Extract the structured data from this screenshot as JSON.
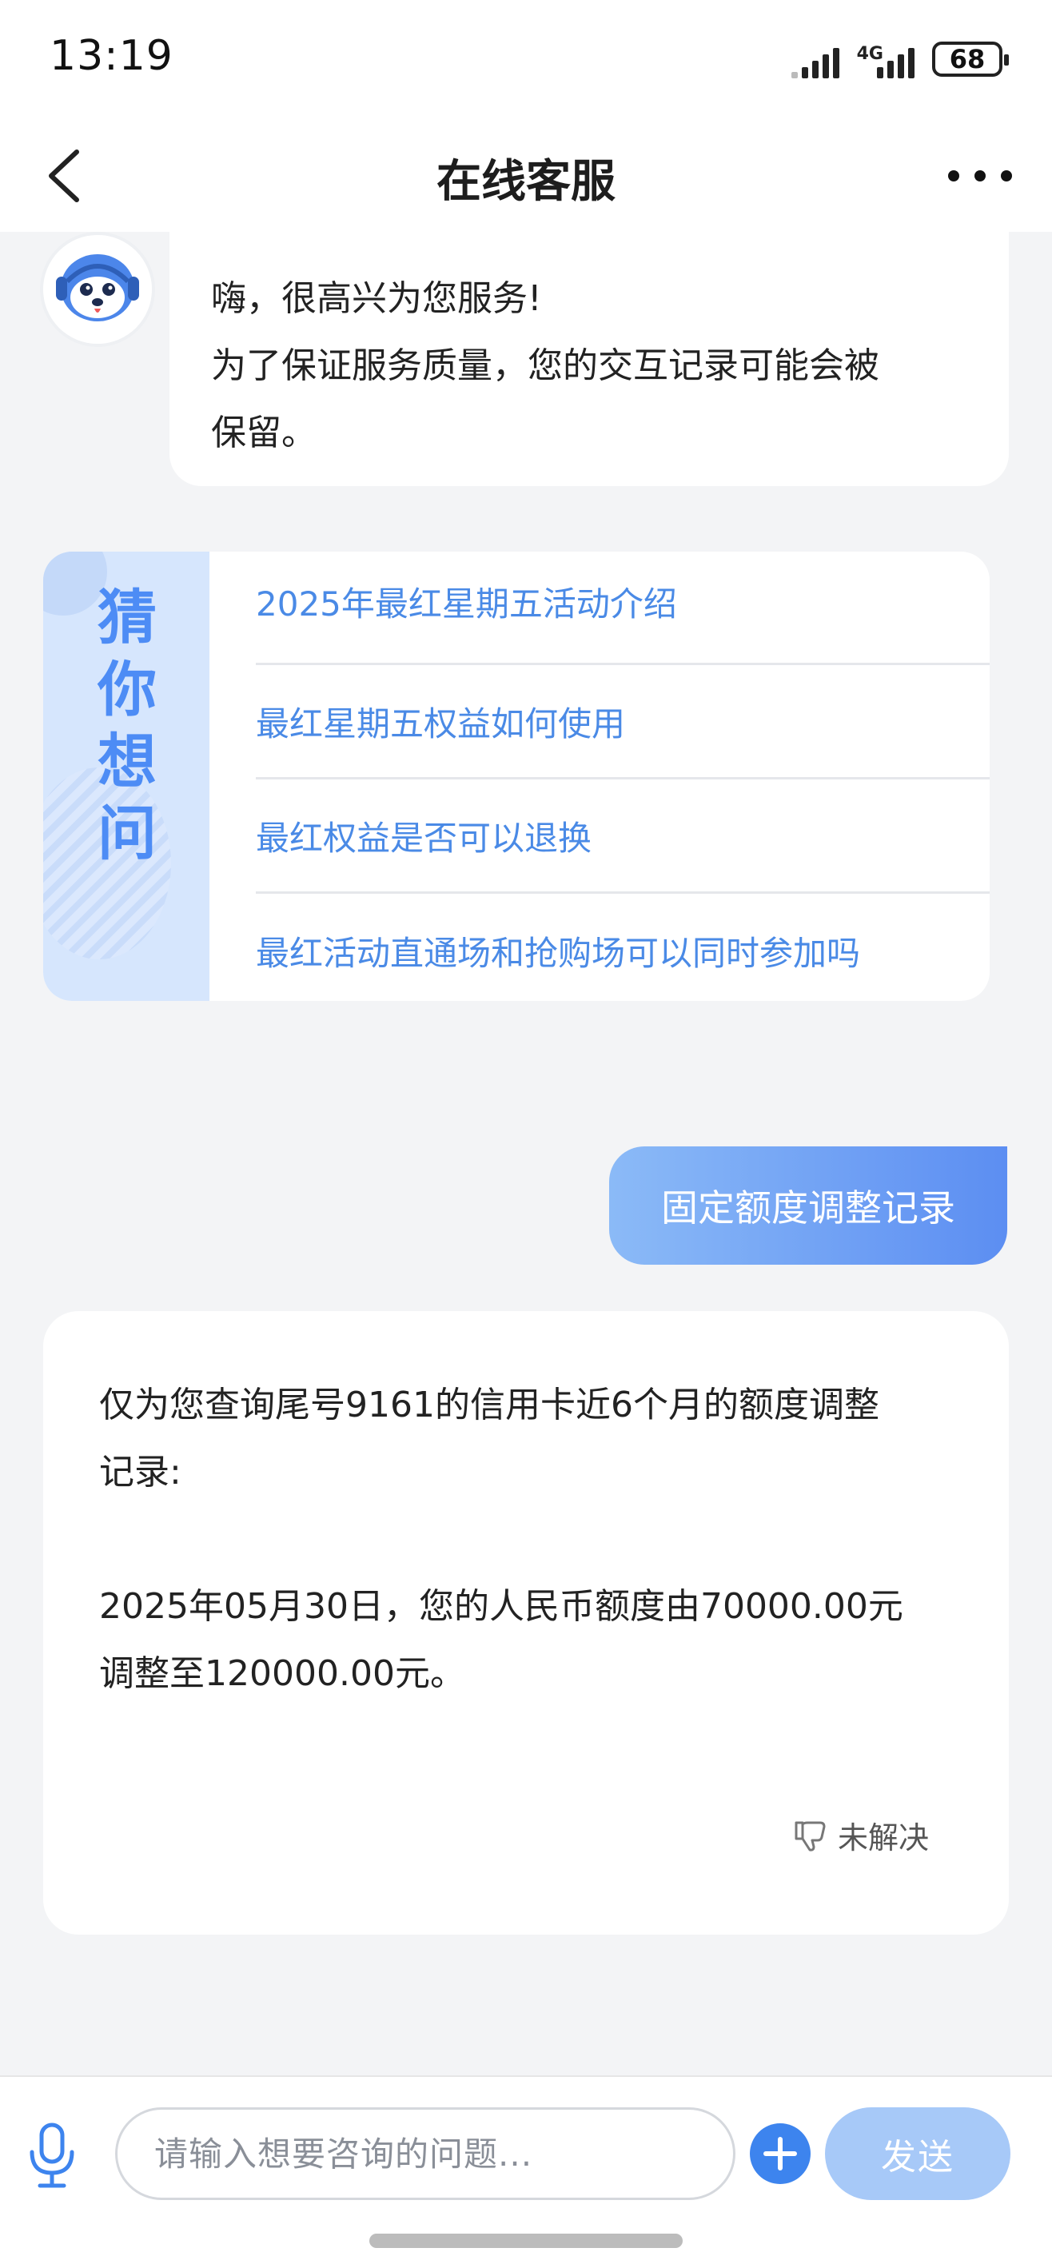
{
  "status_bar": {
    "time": "13:19",
    "network": "4G",
    "battery": "68"
  },
  "nav": {
    "title": "在线客服",
    "back_icon": "chevron-left-icon",
    "more_icon": "more-horizontal-icon"
  },
  "greeting": {
    "avatar_icon": "robot-avatar-icon",
    "line1": "嗨，很高兴为您服务!",
    "line2": "为了保证服务质量，您的交互记录可能会被",
    "line3": "保留。"
  },
  "guess": {
    "title": "猜你想问",
    "items": [
      "2025年最红星期五活动介绍",
      "最红星期五权益如何使用",
      "最红权益是否可以退换",
      "最红活动直通场和抢购场可以同时参加吗"
    ]
  },
  "user_message": "固定额度调整记录",
  "reply": {
    "line1": "仅为您查询尾号9161的信用卡近6个月的额度调整",
    "line2": "记录:",
    "line3": "2025年05月30日，您的人民币额度由70000.00元",
    "line4": "调整至120000.00元。",
    "unresolved_label": "未解决"
  },
  "input": {
    "placeholder": "请输入想要咨询的问题...",
    "send_label": "发送"
  },
  "colors": {
    "accent": "#3d84ee",
    "link": "#4a8ae6",
    "send_disabled": "#a7c9f8",
    "background": "#f3f4f6"
  }
}
